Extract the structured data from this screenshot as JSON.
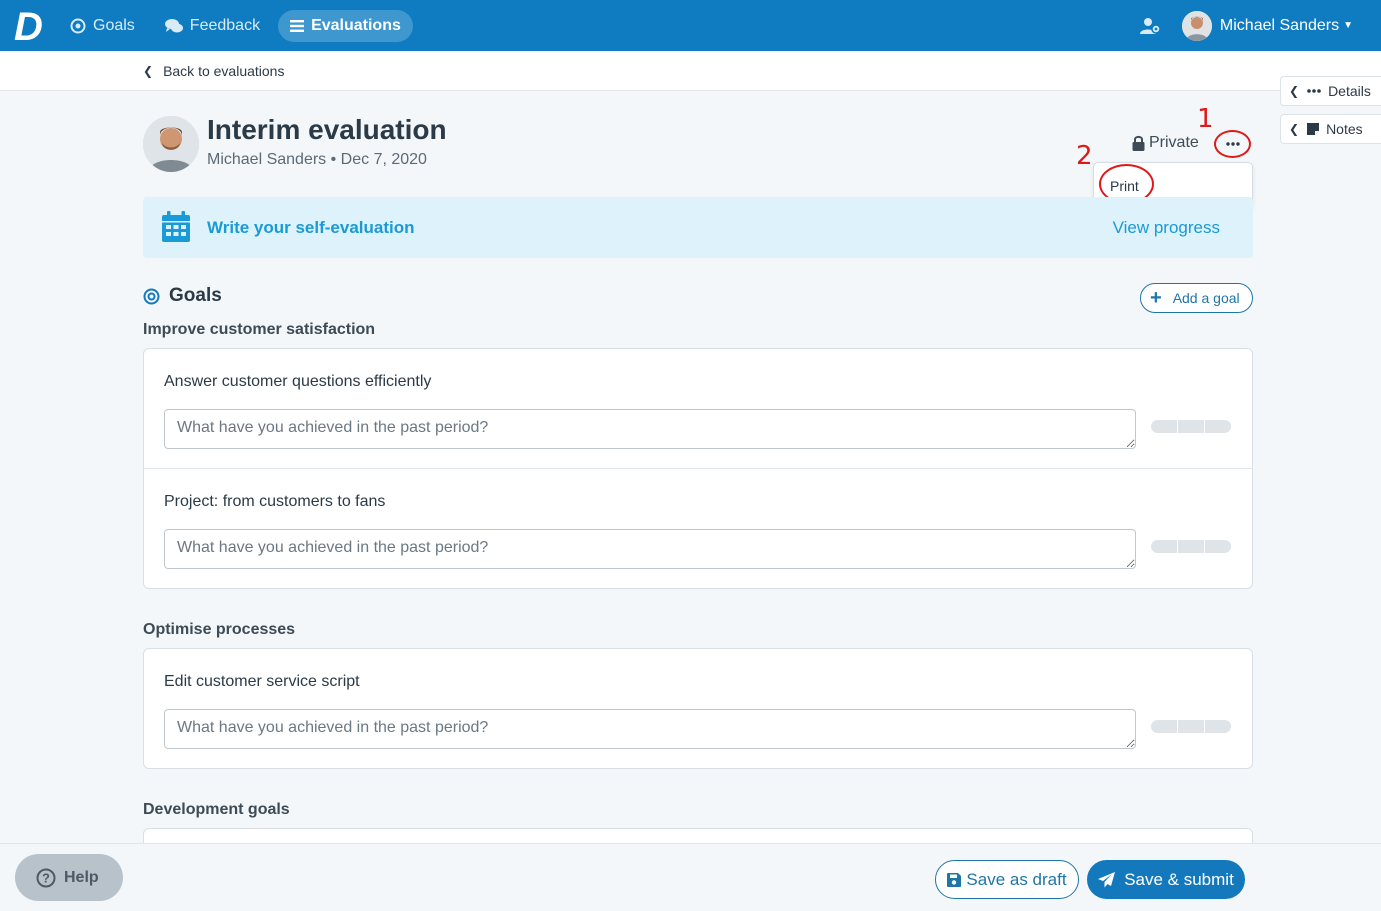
{
  "nav": {
    "logo_letter": "D",
    "items": [
      {
        "label": "Goals",
        "icon": "target-icon"
      },
      {
        "label": "Feedback",
        "icon": "chat-icon"
      },
      {
        "label": "Evaluations",
        "icon": "list-icon",
        "active": true
      }
    ],
    "user_name": "Michael Sanders"
  },
  "back": {
    "label": "Back to evaluations"
  },
  "side_tabs": [
    {
      "label": "Details",
      "icon": "dots-icon"
    },
    {
      "label": "Notes",
      "icon": "note-icon"
    }
  ],
  "header": {
    "title": "Interim evaluation",
    "subtitle": "Michael Sanders • Dec 7, 2020",
    "privacy_label": "Private"
  },
  "annotations": {
    "marker_1": "1",
    "marker_2": "2"
  },
  "menu": {
    "print_label": "Print"
  },
  "banner": {
    "text": "Write your self-evaluation",
    "link": "View progress"
  },
  "goals": {
    "title": "Goals",
    "add_label": "Add a goal",
    "placeholder": "What have you achieved in the past period?",
    "groups": [
      {
        "title": "Improve customer satisfaction",
        "items": [
          "Answer customer questions efficiently",
          "Project: from customers to fans"
        ]
      },
      {
        "title": "Optimise processes",
        "items": [
          "Edit customer service script"
        ]
      },
      {
        "title": "Development goals",
        "items": []
      }
    ]
  },
  "footer": {
    "help_label": "Help",
    "save_draft_label": "Save as draft",
    "save_submit_label": "Save & submit"
  },
  "colors": {
    "brand": "#0f7bc0",
    "accent": "#1a9ad6",
    "annotation": "#e01818"
  }
}
